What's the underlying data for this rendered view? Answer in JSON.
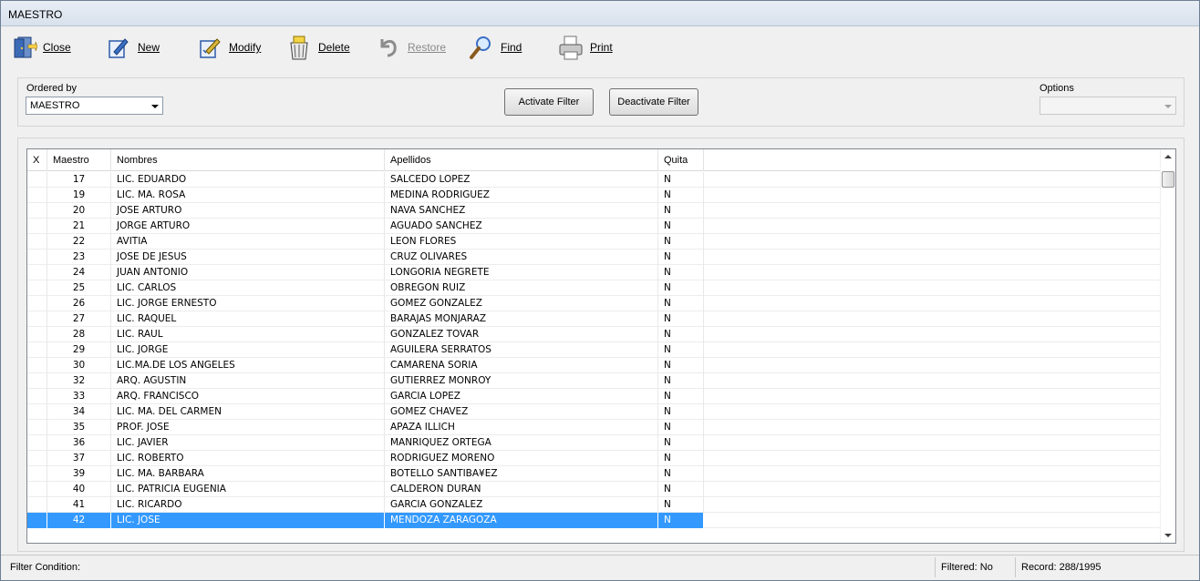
{
  "window": {
    "title": "MAESTRO"
  },
  "toolbar": {
    "buttons": [
      {
        "label": "Close",
        "icon": "exit-door-icon",
        "enabled": true
      },
      {
        "label": "New",
        "icon": "new-record-icon",
        "enabled": true
      },
      {
        "label": "Modify",
        "icon": "modify-record-icon",
        "enabled": true
      },
      {
        "label": "Delete",
        "icon": "trash-can-icon",
        "enabled": true
      },
      {
        "label": "Restore",
        "icon": "undo-arrow-icon",
        "enabled": false
      },
      {
        "label": "Find",
        "icon": "magnifier-icon",
        "enabled": true
      },
      {
        "label": "Print",
        "icon": "printer-icon",
        "enabled": true
      }
    ]
  },
  "filter": {
    "ordered_by_label": "Ordered by",
    "ordered_by_value": "MAESTRO",
    "activate_label": "Activate Filter",
    "deactivate_label": "Deactivate Filter",
    "options_label": "Options",
    "options_value": ""
  },
  "grid": {
    "columns": [
      "X",
      "Maestro",
      "Nombres",
      "Apellidos",
      "Quita"
    ],
    "rows": [
      [
        "17",
        "LIC. EDUARDO",
        "SALCEDO LOPEZ",
        "N"
      ],
      [
        "19",
        "LIC. MA. ROSA",
        "MEDINA RODRIGUEZ",
        "N"
      ],
      [
        "20",
        "JOSE ARTURO",
        "NAVA SANCHEZ",
        "N"
      ],
      [
        "21",
        "JORGE ARTURO",
        "AGUADO SANCHEZ",
        "N"
      ],
      [
        "22",
        "AVITIA",
        "LEON FLORES",
        "N"
      ],
      [
        "23",
        "JOSE DE JESUS",
        "CRUZ OLIVARES",
        "N"
      ],
      [
        "24",
        "JUAN ANTONIO",
        "LONGORIA NEGRETE",
        "N"
      ],
      [
        "25",
        "LIC. CARLOS",
        "OBREGON RUIZ",
        "N"
      ],
      [
        "26",
        "LIC. JORGE ERNESTO",
        "GOMEZ GONZALEZ",
        "N"
      ],
      [
        "27",
        "LIC. RAQUEL",
        "BARAJAS MONJARAZ",
        "N"
      ],
      [
        "28",
        "LIC. RAUL",
        "GONZALEZ TOVAR",
        "N"
      ],
      [
        "29",
        "LIC. JORGE",
        "AGUILERA SERRATOS",
        "N"
      ],
      [
        "30",
        "LIC.MA.DE LOS ANGELES",
        "CAMARENA SORIA",
        "N"
      ],
      [
        "32",
        "ARQ. AGUSTIN",
        "GUTIERREZ MONROY",
        "N"
      ],
      [
        "33",
        "ARQ. FRANCISCO",
        "GARCIA LOPEZ",
        "N"
      ],
      [
        "34",
        "LIC. MA. DEL CARMEN",
        "GOMEZ CHAVEZ",
        "N"
      ],
      [
        "35",
        "PROF. JOSE",
        "APAZA ILLICH",
        "N"
      ],
      [
        "36",
        "LIC. JAVIER",
        "MANRIQUEZ ORTEGA",
        "N"
      ],
      [
        "37",
        "LIC. ROBERTO",
        "RODRIGUEZ MORENO",
        "N"
      ],
      [
        "39",
        "LIC. MA. BARBARA",
        "BOTELLO SANTIBA¥EZ",
        "N"
      ],
      [
        "40",
        "LIC. PATRICIA EUGENIA",
        "CALDERON DURAN",
        "N"
      ],
      [
        "41",
        "LIC. RICARDO",
        "GARCIA GONZALEZ",
        "N"
      ],
      [
        "42",
        "LIC. JOSE",
        "MENDOZA ZARAGOZA",
        "N"
      ]
    ],
    "selected_maestro": "42"
  },
  "status": {
    "filter_condition": "Filter Condition:",
    "filtered": "Filtered: No",
    "record": "Record: 288/1995"
  },
  "colors": {
    "selection": "#3399ff",
    "window_bg": "#f0f0f0"
  }
}
